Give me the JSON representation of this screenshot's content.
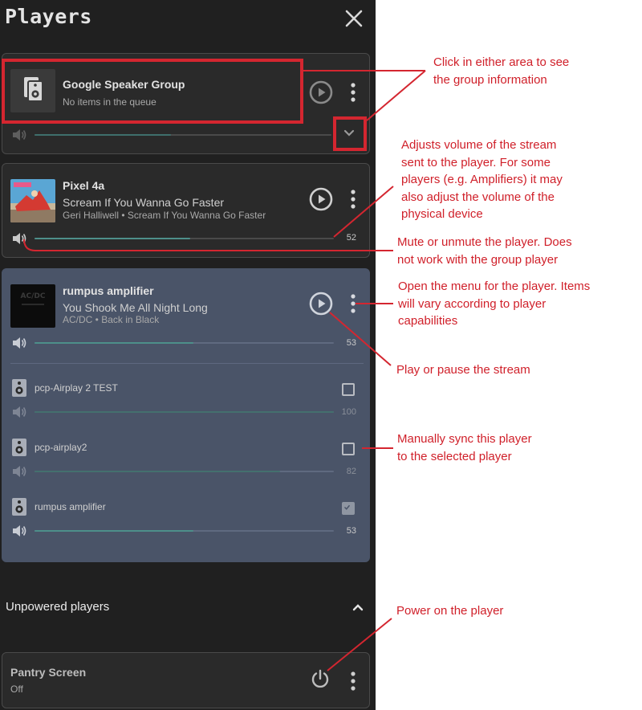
{
  "panel": {
    "title": "Players"
  },
  "players": [
    {
      "name": "Google Speaker Group",
      "track": "",
      "subtitle": "No items in the queue",
      "volume": 46,
      "volume_label": ""
    },
    {
      "name": "Pixel 4a",
      "track": "Scream If You Wanna Go Faster",
      "subtitle": "Geri Halliwell • Scream If You Wanna Go Faster",
      "volume": 52,
      "volume_label": "52"
    },
    {
      "name": "rumpus amplifier",
      "track": "You Shook Me All Night Long",
      "subtitle": "AC/DC • Back in Black",
      "volume": 53,
      "volume_label": "53"
    }
  ],
  "sync_members": [
    {
      "name": "pcp-Airplay 2 TEST",
      "volume": 100,
      "volume_label": "100",
      "checked": false
    },
    {
      "name": "pcp-airplay2",
      "volume": 82,
      "volume_label": "82",
      "checked": false
    },
    {
      "name": "rumpus amplifier",
      "volume": 53,
      "volume_label": "53",
      "checked": true
    }
  ],
  "unpowered": {
    "title": "Unpowered players",
    "players": [
      {
        "name": "Pantry Screen",
        "status": "Off"
      }
    ]
  },
  "annotations": {
    "group_info": [
      "Click in either area to see",
      "the group information"
    ],
    "volume": [
      "Adjusts volume of the stream",
      "sent to the player. For some",
      "players (e.g. Amplifiers) it may",
      "also adjust the volume of the",
      "physical device"
    ],
    "mute": [
      "Mute or unmute the player. Does",
      "not work with the group player"
    ],
    "menu": [
      "Open the menu for the player. Items",
      "will vary according to player",
      "capabilities"
    ],
    "play": [
      "Play or pause the stream"
    ],
    "sync": [
      "Manually sync this player",
      "to the selected player"
    ],
    "power": [
      "Power on the player"
    ]
  },
  "colors": {
    "accent": "#4d8f8a",
    "annotation": "#d0202a",
    "selected_card": "#4a5468",
    "panel": "#202020"
  },
  "icons": [
    "close-icon",
    "speaker-icon",
    "play-circle-icon",
    "more-vert-icon",
    "volume-icon",
    "chevron-down-icon",
    "chevron-up-icon",
    "checkbox-icon",
    "power-icon"
  ]
}
